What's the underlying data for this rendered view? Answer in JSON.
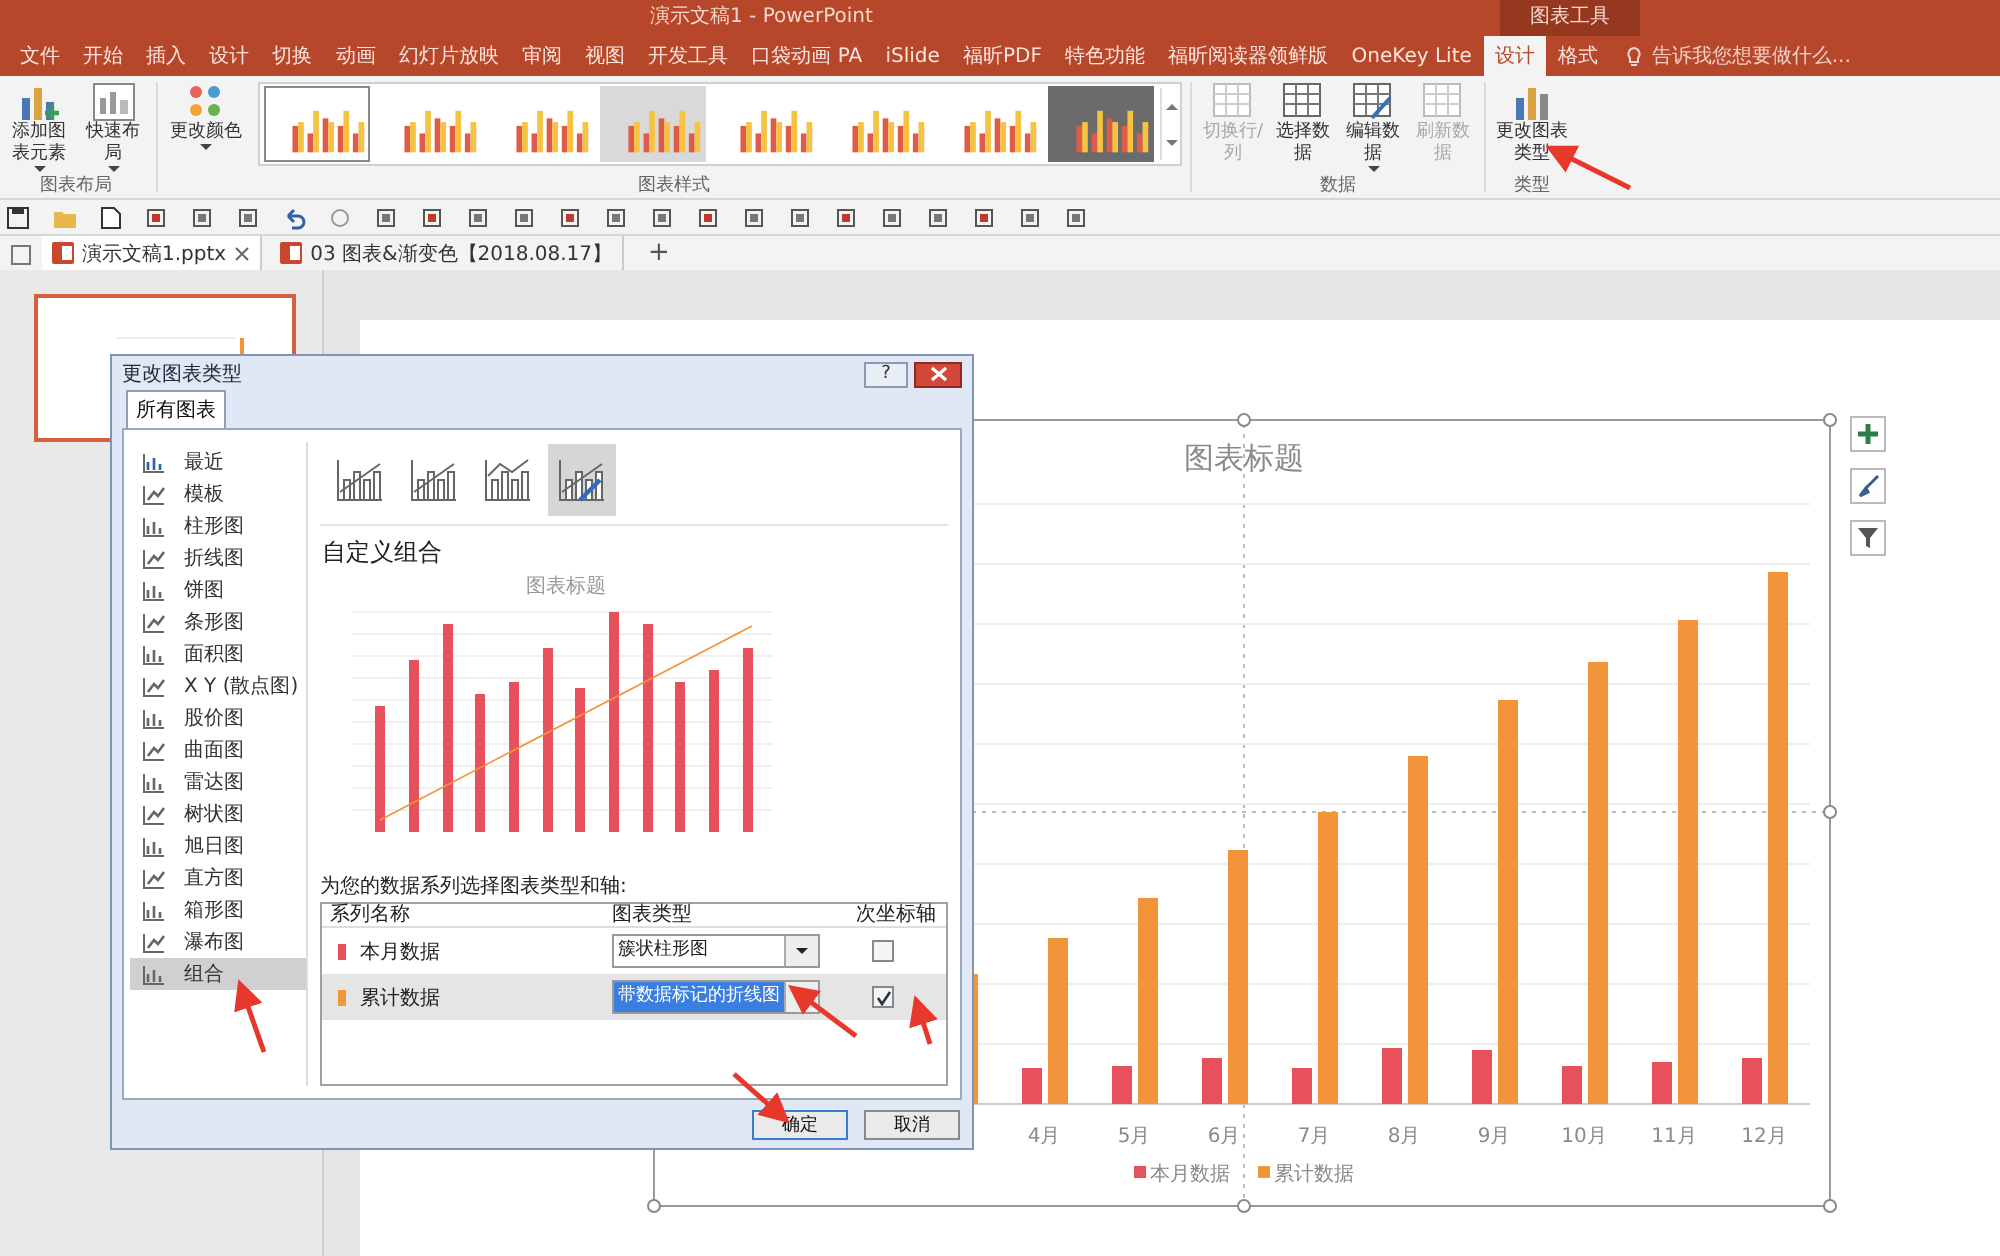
{
  "title_bar": {
    "title": "演示文稿1 - PowerPoint",
    "context_label": "图表工具"
  },
  "ribbon_tabs": [
    {
      "label": "文件",
      "selected": false
    },
    {
      "label": "开始",
      "selected": false
    },
    {
      "label": "插入",
      "selected": false
    },
    {
      "label": "设计",
      "selected": false
    },
    {
      "label": "切换",
      "selected": false
    },
    {
      "label": "动画",
      "selected": false
    },
    {
      "label": "幻灯片放映",
      "selected": false
    },
    {
      "label": "审阅",
      "selected": false
    },
    {
      "label": "视图",
      "selected": false
    },
    {
      "label": "开发工具",
      "selected": false
    },
    {
      "label": "口袋动画 PA",
      "selected": false
    },
    {
      "label": "iSlide",
      "selected": false
    },
    {
      "label": "福昕PDF",
      "selected": false
    },
    {
      "label": "特色功能",
      "selected": false
    },
    {
      "label": "福昕阅读器领鲜版",
      "selected": false
    },
    {
      "label": "OneKey Lite",
      "selected": false
    },
    {
      "label": "设计",
      "selected": true
    },
    {
      "label": "格式",
      "selected": false
    }
  ],
  "tell_me": {
    "placeholder": "告诉我您想要做什么..."
  },
  "ribbon": {
    "layout_group": {
      "label": "图表布局",
      "buttons": [
        {
          "label": "添加图表元素",
          "dropdown": true
        },
        {
          "label": "快速布局",
          "dropdown": true
        }
      ]
    },
    "styles_group": {
      "label": "图表样式",
      "color_button": {
        "label": "更改颜色",
        "dropdown": true
      },
      "styles": [
        {
          "kind": "light",
          "selected": true
        },
        {
          "kind": "light",
          "selected": false
        },
        {
          "kind": "light",
          "selected": false
        },
        {
          "kind": "gray",
          "selected": false
        },
        {
          "kind": "light",
          "selected": false
        },
        {
          "kind": "light",
          "selected": false
        },
        {
          "kind": "light",
          "selected": false
        },
        {
          "kind": "dark",
          "selected": false
        }
      ]
    },
    "data_group": {
      "label": "数据",
      "buttons": [
        {
          "label": "切换行/列",
          "disabled": true,
          "dropdown": false
        },
        {
          "label": "选择数据",
          "disabled": false,
          "dropdown": false
        },
        {
          "label": "编辑数据",
          "disabled": false,
          "dropdown": true
        },
        {
          "label": "刷新数据",
          "disabled": true,
          "dropdown": false
        }
      ]
    },
    "type_group": {
      "label": "类型",
      "button": {
        "label": "更改图表类型"
      }
    }
  },
  "doc_tabs": [
    {
      "label": "演示文稿1.pptx",
      "selected": true,
      "closable": true
    },
    {
      "label": "03 图表&渐变色【2018.08.17】",
      "selected": false,
      "closable": false
    }
  ],
  "new_tab": "+",
  "thumbnails": [
    {
      "selected": true
    }
  ],
  "slide_chart": {
    "title": "图表标题",
    "x_labels": [
      "4月",
      "5月",
      "6月",
      "7月",
      "8月",
      "9月",
      "10月",
      "11月",
      "12月"
    ],
    "legend": [
      {
        "name": "本月数据",
        "color": "#e8505b"
      },
      {
        "name": "累计数据",
        "color": "#f29439"
      }
    ]
  },
  "dialog": {
    "title": "更改图表类型",
    "help": "?",
    "tabs": [
      {
        "label": "所有图表",
        "selected": true
      }
    ],
    "categories": [
      {
        "label": "最近",
        "selected": false
      },
      {
        "label": "模板",
        "selected": false
      },
      {
        "label": "柱形图",
        "selected": false
      },
      {
        "label": "折线图",
        "selected": false
      },
      {
        "label": "饼图",
        "selected": false
      },
      {
        "label": "条形图",
        "selected": false
      },
      {
        "label": "面积图",
        "selected": false
      },
      {
        "label": "X Y (散点图)",
        "selected": false
      },
      {
        "label": "股价图",
        "selected": false
      },
      {
        "label": "曲面图",
        "selected": false
      },
      {
        "label": "雷达图",
        "selected": false
      },
      {
        "label": "树状图",
        "selected": false
      },
      {
        "label": "旭日图",
        "selected": false
      },
      {
        "label": "直方图",
        "selected": false
      },
      {
        "label": "箱形图",
        "selected": false
      },
      {
        "label": "瀑布图",
        "selected": false
      },
      {
        "label": "组合",
        "selected": true
      }
    ],
    "subtypes": [
      {
        "selected": false
      },
      {
        "selected": false
      },
      {
        "selected": false
      },
      {
        "selected": true
      }
    ],
    "subtype_title": "自定义组合",
    "preview_title": "图表标题",
    "series_prompt": "为您的数据系列选择图表类型和轴:",
    "series_columns": [
      "系列名称",
      "图表类型",
      "次坐标轴"
    ],
    "series": [
      {
        "name": "本月数据",
        "color": "#e8505b",
        "chart_type": "簇状柱形图",
        "secondary_axis": false,
        "selected": false
      },
      {
        "name": "累计数据",
        "color": "#f29439",
        "chart_type": "带数据标记的折线图",
        "secondary_axis": true,
        "selected": true
      }
    ],
    "buttons": [
      {
        "label": "确定",
        "default": true
      },
      {
        "label": "取消",
        "default": false
      }
    ]
  }
}
